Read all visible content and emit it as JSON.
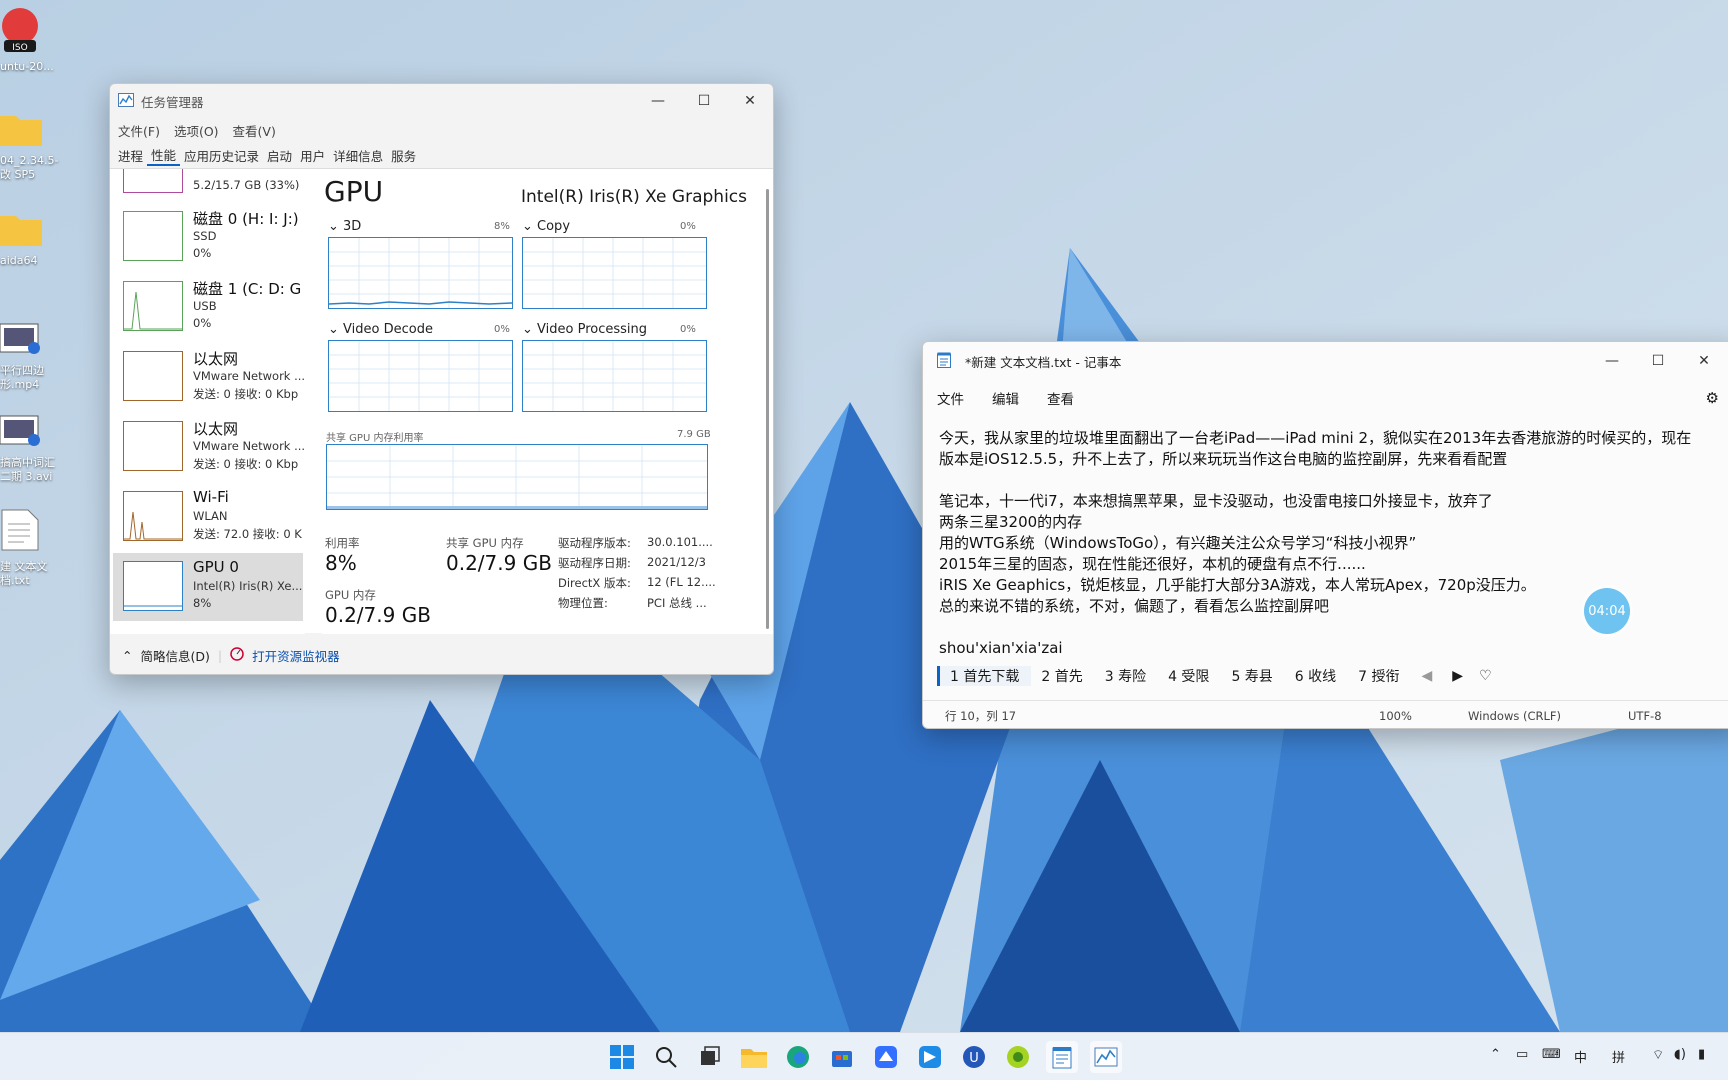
{
  "desktop": {
    "icons": [
      {
        "label": "untu-20...",
        "icon": "iso-disc-icon"
      },
      {
        "label": "04_2.34.5-\n改 SP5",
        "icon": "folder-icon"
      },
      {
        "label": "aida64",
        "icon": "folder-icon"
      },
      {
        "label": "平行四边\n形.mp4",
        "icon": "video-file-icon"
      },
      {
        "label": "搞高中词汇\n二期 3.avi",
        "icon": "video-file-icon"
      },
      {
        "label": "建 文本文\n档.txt",
        "icon": "text-file-icon"
      }
    ]
  },
  "task_manager": {
    "title": "任务管理器",
    "menu": [
      "文件(F)",
      "选项(O)",
      "查看(V)"
    ],
    "tabs": [
      "进程",
      "性能",
      "应用历史记录",
      "启动",
      "用户",
      "详细信息",
      "服务"
    ],
    "active_tab": "性能",
    "sidebar": [
      {
        "name": "",
        "line2": "5.2/15.7 GB (33%)",
        "line3": ""
      },
      {
        "name": "磁盘 0 (H: I: J:)",
        "line2": "SSD",
        "line3": "0%"
      },
      {
        "name": "磁盘 1 (C: D: G",
        "line2": "USB",
        "line3": "0%"
      },
      {
        "name": "以太网",
        "line2": "VMware Network ...",
        "line3": "发送: 0 接收: 0 Kbp"
      },
      {
        "name": "以太网",
        "line2": "VMware Network ...",
        "line3": "发送: 0 接收: 0 Kbp"
      },
      {
        "name": "Wi-Fi",
        "line2": "WLAN",
        "line3": "发送: 72.0 接收: 0 K"
      },
      {
        "name": "GPU 0",
        "line2": "Intel(R) Iris(R) Xe...",
        "line3": "8%"
      }
    ],
    "gpu": {
      "title": "GPU",
      "model": "Intel(R) Iris(R) Xe Graphics",
      "engines": [
        {
          "name": "3D",
          "percent": "8%"
        },
        {
          "name": "Copy",
          "percent": "0%"
        },
        {
          "name": "Video Decode",
          "percent": "0%"
        },
        {
          "name": "Video Processing",
          "percent": "0%"
        }
      ],
      "shared_label": "共享 GPU 内存利用率",
      "shared_max": "7.9 GB",
      "stats": {
        "util_label": "利用率",
        "util_value": "8%",
        "shared_mem_label": "共享 GPU 内存",
        "shared_mem_value": "0.2/7.9 GB",
        "gpu_mem_label": "GPU 内存",
        "gpu_mem_value": "0.2/7.9 GB"
      },
      "details": [
        {
          "k": "驱动程序版本:",
          "v": "30.0.101...."
        },
        {
          "k": "驱动程序日期:",
          "v": "2021/12/3"
        },
        {
          "k": "DirectX 版本:",
          "v": "12 (FL 12...."
        },
        {
          "k": "物理位置:",
          "v": "PCI 总线 ..."
        }
      ]
    },
    "footer": {
      "less": "简略信息(D)",
      "monitor": "打开资源监视器"
    }
  },
  "notepad": {
    "title": "*新建 文本文档.txt - 记事本",
    "menu": [
      "文件",
      "编辑",
      "查看"
    ],
    "text": "今天，我从家里的垃圾堆里面翻出了一台老iPad——iPad mini 2，貌似实在2013年去香港旅游的时候买的，现在\n版本是iOS12.5.5，升不上去了，所以来玩玩当作这台电脑的监控副屏，先来看看配置\n\n笔记本，十一代i7，本来想搞黑苹果，显卡没驱动，也没雷电接口外接显卡，放弃了\n两条三星3200的内存\n用的WTG系统（WindowsToGo），有兴趣关注公众号学习“科技小视界”\n2015年三星的固态，现在性能还很好，本机的硬盘有点不行......\niRIS Xe Geaphics，锐炬核显，几乎能打大部分3A游戏，本人常玩Apex，720p没压力。\n总的来说不错的系统，不对，偏题了，看看怎么监控副屏吧\n\nshou'xian'xia'zai",
    "ime_candidates": [
      "1 首先下载",
      "2 首先",
      "3 寿险",
      "4 受限",
      "5 寿县",
      "6 收线",
      "7 授衔"
    ],
    "status": {
      "pos": "行 10，列 17",
      "zoom": "100%",
      "eol": "Windows (CRLF)",
      "enc": "UTF-8"
    }
  },
  "timer": "04:04",
  "tray": {
    "lang": "中",
    "ime": "拼"
  }
}
